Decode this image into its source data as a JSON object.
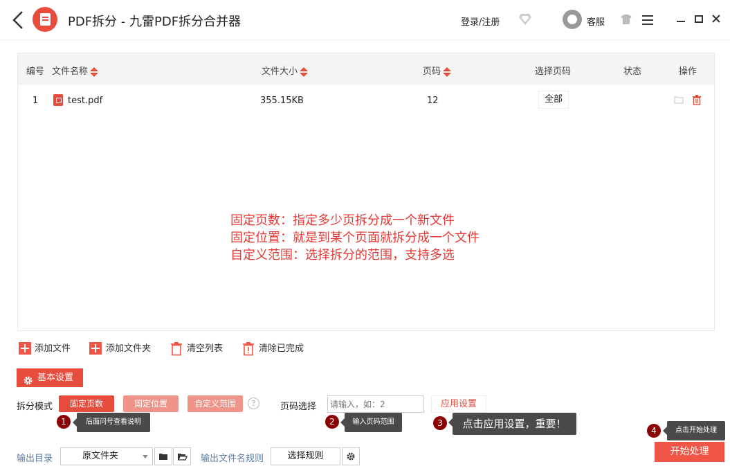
{
  "titlebar": {
    "title": "PDF拆分 - 九雷PDF拆分合并器",
    "login": "登录/注册",
    "customer_service": "客服",
    "icons": [
      "back-icon",
      "app-logo",
      "diamond-icon",
      "headset-avatar",
      "skin-icon",
      "menu-icon",
      "minimize-icon",
      "maximize-icon",
      "close-icon"
    ]
  },
  "table": {
    "columns": [
      "编号",
      "文件名称",
      "文件大小",
      "页码",
      "选择页码",
      "状态",
      "操作"
    ],
    "rows": [
      {
        "index": "1",
        "name": "test.pdf",
        "size": "355.15KB",
        "pages": "12",
        "page_select": "全部",
        "status": ""
      }
    ]
  },
  "notes": [
    "固定页数：指定多少页拆分成一个新文件",
    "固定位置：就是到某个页面就拆分成一个文件",
    "自定义范围：选择拆分的范围，支持多选"
  ],
  "toolbar": {
    "add_file": "添加文件",
    "add_folder": "添加文件夹",
    "clear_list": "清空列表",
    "clear_done": "清除已完成"
  },
  "settings": {
    "basic_label": "基本设置",
    "split_mode_label": "拆分模式",
    "modes": [
      "固定页数",
      "固定位置",
      "自定义范围"
    ],
    "page_select_label": "页码选择",
    "page_input_placeholder": "请输入，如：2",
    "apply_label": "应用设置"
  },
  "tips": [
    {
      "num": "1",
      "text": "后面问号查看说明"
    },
    {
      "num": "2",
      "text": "输入页码范围"
    },
    {
      "num": "3",
      "text": "点击应用设置，重要！"
    },
    {
      "num": "4",
      "text": "点击开始处理"
    }
  ],
  "output": {
    "dir_label": "输出目录",
    "dir_value": "原文件夹",
    "name_rule_label": "输出文件名规则",
    "rule_button": "选择规则",
    "start_button": "开始处理"
  },
  "colors": {
    "accent": "#e74c3c",
    "accent_light": "#f0948a",
    "tip_bg": "#4a4a4a",
    "tip_num": "#8b0000",
    "link": "#5b7fa6"
  }
}
